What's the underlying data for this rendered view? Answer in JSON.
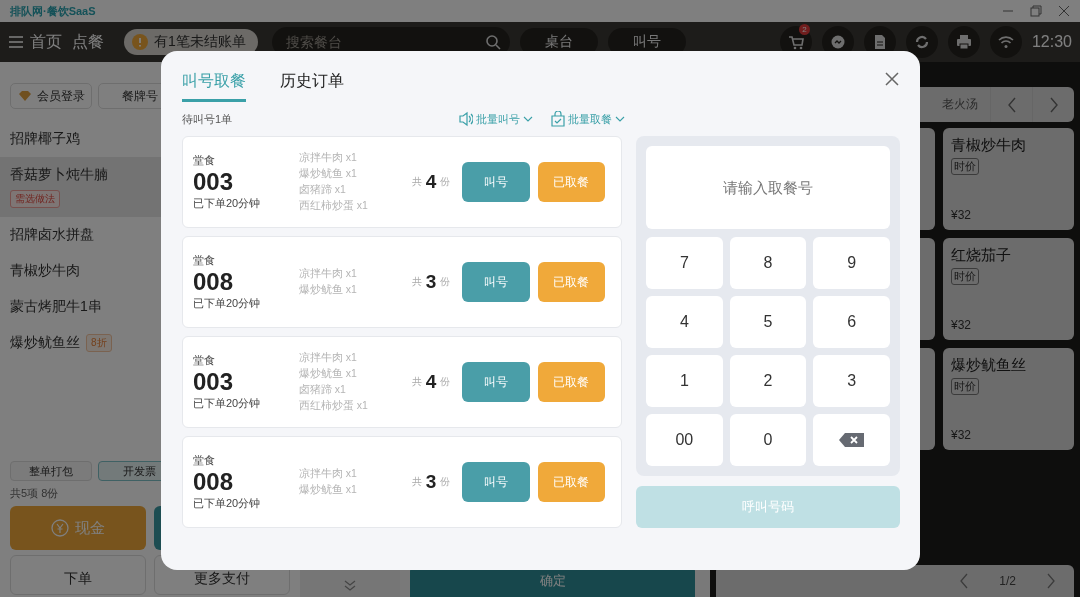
{
  "title_bar": {
    "app_name": "排队网·餐饮SaaS"
  },
  "top_bar": {
    "home": "首页",
    "order": "点餐",
    "unpaid_notice": "有1笔未结账单",
    "search": {
      "placeholder": "搜索餐台"
    },
    "pills": [
      "桌台",
      "叫号"
    ],
    "cart_badge": "2",
    "time": "12:30"
  },
  "left_panel": {
    "buttons": [
      {
        "label": "会员登录",
        "kind": "member"
      },
      {
        "label": "餐牌号",
        "kind": "plain"
      }
    ],
    "items": [
      {
        "kind": "plain",
        "name": "招牌椰子鸡",
        "selected": false
      },
      {
        "kind": "needs_option",
        "name": "香菇萝卜炖牛腩",
        "selected": true,
        "tag": "需选做法"
      },
      {
        "kind": "plain",
        "name": "招牌卤水拼盘",
        "selected": false
      },
      {
        "kind": "plain",
        "name": "青椒炒牛肉",
        "selected": false
      },
      {
        "kind": "plain",
        "name": "蒙古烤肥牛1串",
        "selected": false
      },
      {
        "kind": "discount",
        "name": "爆炒鱿鱼丝",
        "selected": false,
        "tag": "8折"
      }
    ],
    "options": [
      {
        "label": "整单打包",
        "selected": false
      },
      {
        "label": "开发票",
        "selected": true
      }
    ],
    "summary": "共5项 8份",
    "pay_buttons": [
      {
        "label": "现金",
        "kind": "cash"
      },
      {
        "kind": "secondary"
      }
    ],
    "actions": [
      "下单",
      "更多支付"
    ]
  },
  "confirm_button": "确定",
  "menu": {
    "categories": [
      "老火汤"
    ],
    "dishes": [
      {
        "name": "青椒炒牛肉",
        "tag": "时价",
        "price": "¥32"
      },
      {
        "name": "红烧茄子",
        "tag": "时价",
        "price": "¥32"
      },
      {
        "name": "爆炒鱿鱼丝",
        "tag": "时价",
        "price": "¥32"
      }
    ],
    "page": "1/2"
  },
  "dialog": {
    "tabs": [
      {
        "label": "叫号取餐",
        "selected": true
      },
      {
        "label": "历史订单",
        "selected": false
      }
    ],
    "pending": "待叫号1单",
    "batch_actions": [
      {
        "label": "批量叫号",
        "kind": "call"
      },
      {
        "label": "批量取餐",
        "kind": "pickup"
      }
    ],
    "orders": [
      {
        "type": "堂食",
        "number": "003",
        "time": "已下单20分钟",
        "items": [
          "凉拌牛肉 x1",
          "爆炒鱿鱼 x1",
          "卤猪蹄 x1",
          "西红柿炒蛋 x1"
        ],
        "total_prefix": "共",
        "total": "4",
        "total_suffix": "份",
        "call": "叫号",
        "picked": "已取餐"
      },
      {
        "type": "堂食",
        "number": "008",
        "time": "已下单20分钟",
        "items": [
          "凉拌牛肉 x1",
          "爆炒鱿鱼 x1"
        ],
        "total_prefix": "共",
        "total": "3",
        "total_suffix": "份",
        "call": "叫号",
        "picked": "已取餐"
      },
      {
        "type": "堂食",
        "number": "003",
        "time": "已下单20分钟",
        "items": [
          "凉拌牛肉 x1",
          "爆炒鱿鱼 x1",
          "卤猪蹄 x1",
          "西红柿炒蛋 x1"
        ],
        "total_prefix": "共",
        "total": "4",
        "total_suffix": "份",
        "call": "叫号",
        "picked": "已取餐"
      },
      {
        "type": "堂食",
        "number": "008",
        "time": "已下单20分钟",
        "items": [
          "凉拌牛肉 x1",
          "爆炒鱿鱼 x1"
        ],
        "total_prefix": "共",
        "total": "3",
        "total_suffix": "份",
        "call": "叫号",
        "picked": "已取餐"
      }
    ],
    "input": {
      "placeholder": "请输入取餐号"
    },
    "keys": [
      {
        "kind": "digit",
        "label": "7"
      },
      {
        "kind": "digit",
        "label": "8"
      },
      {
        "kind": "digit",
        "label": "9"
      },
      {
        "kind": "digit",
        "label": "4"
      },
      {
        "kind": "digit",
        "label": "5"
      },
      {
        "kind": "digit",
        "label": "6"
      },
      {
        "kind": "digit",
        "label": "1"
      },
      {
        "kind": "digit",
        "label": "2"
      },
      {
        "kind": "digit",
        "label": "3"
      },
      {
        "kind": "digit",
        "label": "00"
      },
      {
        "kind": "digit",
        "label": "0"
      },
      {
        "kind": "backspace"
      }
    ],
    "call_button": {
      "label": "呼叫号码",
      "disabled": true
    }
  }
}
